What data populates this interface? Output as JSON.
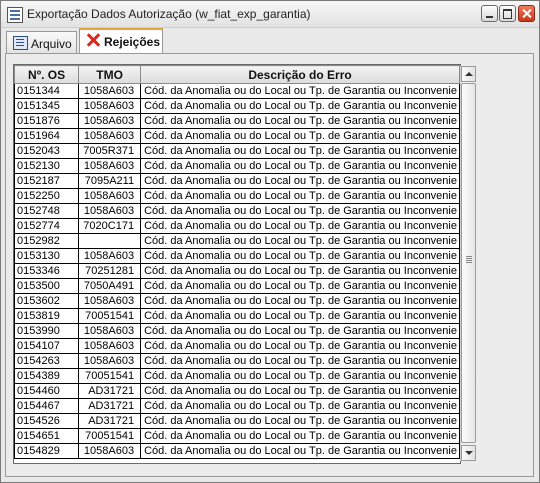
{
  "window": {
    "title": "Exportação Dados Autorização (w_fiat_exp_garantia)"
  },
  "tabs": [
    {
      "label": "Arquivo",
      "icon": "list-icon",
      "active": false
    },
    {
      "label": "Rejeições",
      "icon": "x-icon",
      "active": true
    }
  ],
  "table": {
    "headers": [
      "Nº. OS",
      "TMO",
      "Descrição do Erro"
    ],
    "rows": [
      [
        "0151344",
        "1058A603",
        "Cód. da Anomalia ou do Local ou Tp. de Garantia ou Inconvenie"
      ],
      [
        "0151345",
        "1058A603",
        "Cód. da Anomalia ou do Local ou Tp. de Garantia ou Inconvenie"
      ],
      [
        "0151876",
        "1058A603",
        "Cód. da Anomalia ou do Local ou Tp. de Garantia ou Inconvenie"
      ],
      [
        "0151964",
        "1058A603",
        "Cód. da Anomalia ou do Local ou Tp. de Garantia ou Inconvenie"
      ],
      [
        "0152043",
        "7005R371",
        "Cód. da Anomalia ou do Local ou Tp. de Garantia ou Inconvenie"
      ],
      [
        "0152130",
        "1058A603",
        "Cód. da Anomalia ou do Local ou Tp. de Garantia ou Inconvenie"
      ],
      [
        "0152187",
        "7095A211",
        "Cód. da Anomalia ou do Local ou Tp. de Garantia ou Inconvenie"
      ],
      [
        "0152250",
        "1058A603",
        "Cód. da Anomalia ou do Local ou Tp. de Garantia ou Inconvenie"
      ],
      [
        "0152748",
        "1058A603",
        "Cód. da Anomalia ou do Local ou Tp. de Garantia ou Inconvenie"
      ],
      [
        "0152774",
        "7020C171",
        "Cód. da Anomalia ou do Local ou Tp. de Garantia ou Inconvenie"
      ],
      [
        "0152982",
        "",
        "Cód. da Anomalia ou do Local ou Tp. de Garantia ou Inconvenie"
      ],
      [
        "0153130",
        "1058A603",
        "Cód. da Anomalia ou do Local ou Tp. de Garantia ou Inconvenie"
      ],
      [
        "0153346",
        "70251281",
        "Cód. da Anomalia ou do Local ou Tp. de Garantia ou Inconvenie"
      ],
      [
        "0153500",
        "7050A491",
        "Cód. da Anomalia ou do Local ou Tp. de Garantia ou Inconvenie"
      ],
      [
        "0153602",
        "1058A603",
        "Cód. da Anomalia ou do Local ou Tp. de Garantia ou Inconvenie"
      ],
      [
        "0153819",
        "70051541",
        "Cód. da Anomalia ou do Local ou Tp. de Garantia ou Inconvenie"
      ],
      [
        "0153990",
        "1058A603",
        "Cód. da Anomalia ou do Local ou Tp. de Garantia ou Inconvenie"
      ],
      [
        "0154107",
        "1058A603",
        "Cód. da Anomalia ou do Local ou Tp. de Garantia ou Inconvenie"
      ],
      [
        "0154263",
        "1058A603",
        "Cód. da Anomalia ou do Local ou Tp. de Garantia ou Inconvenie"
      ],
      [
        "0154389",
        "70051541",
        "Cód. da Anomalia ou do Local ou Tp. de Garantia ou Inconvenie"
      ],
      [
        "0154460",
        "AD31721",
        "Cód. da Anomalia ou do Local ou Tp. de Garantia ou Inconvenie"
      ],
      [
        "0154467",
        "AD31721",
        "Cód. da Anomalia ou do Local ou Tp. de Garantia ou Inconvenie"
      ],
      [
        "0154526",
        "AD31721",
        "Cód. da Anomalia ou do Local ou Tp. de Garantia ou Inconvenie"
      ],
      [
        "0154651",
        "70051541",
        "Cód. da Anomalia ou do Local ou Tp. de Garantia ou Inconvenie"
      ],
      [
        "0154829",
        "1058A603",
        "Cód. da Anomalia ou do Local ou Tp. de Garantia ou Inconvenie"
      ]
    ]
  },
  "colors": {
    "active_tab_accent": "#e6a33c",
    "close_button": "#c7381a"
  }
}
